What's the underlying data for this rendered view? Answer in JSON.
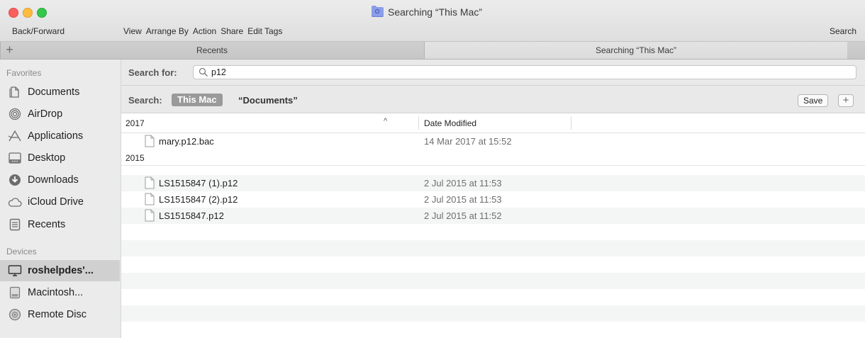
{
  "window": {
    "title": "Searching “This Mac”",
    "toolbar": {
      "back_forward": "Back/Forward",
      "menu": [
        "View",
        "Arrange By",
        "Action",
        "Share",
        "Edit Tags"
      ],
      "search": "Search"
    }
  },
  "tabs": [
    {
      "label": "Recents",
      "active": false
    },
    {
      "label": "Searching “This Mac”",
      "active": true
    }
  ],
  "tab_add_label": "+",
  "sidebar": {
    "favorites_header": "Favorites",
    "favorites": [
      {
        "label": "Documents",
        "icon": "documents-icon"
      },
      {
        "label": "AirDrop",
        "icon": "airdrop-icon"
      },
      {
        "label": "Applications",
        "icon": "applications-icon"
      },
      {
        "label": "Desktop",
        "icon": "desktop-icon"
      },
      {
        "label": "Downloads",
        "icon": "downloads-icon"
      },
      {
        "label": "iCloud Drive",
        "icon": "icloud-icon"
      },
      {
        "label": "Recents",
        "icon": "recents-icon"
      }
    ],
    "devices_header": "Devices",
    "devices": [
      {
        "label": "roshelpdes'...",
        "icon": "computer-icon",
        "selected": true
      },
      {
        "label": "Macintosh...",
        "icon": "hard-drive-icon",
        "selected": false
      },
      {
        "label": "Remote Disc",
        "icon": "disc-icon",
        "selected": false
      }
    ]
  },
  "search": {
    "label": "Search for:",
    "value": "p12"
  },
  "scope": {
    "label": "Search:",
    "this_mac": "This Mac",
    "documents": "“Documents”",
    "save_label": "Save",
    "add_label": "+"
  },
  "columns": {
    "name": "2017",
    "sort_indicator": "^",
    "date": "Date Modified"
  },
  "groups": [
    {
      "label": "2017",
      "files": [
        {
          "name": "mary.p12.bac",
          "date": "14 Mar 2017 at 15:52"
        }
      ]
    },
    {
      "label": "2015",
      "files": [
        {
          "name": "LS1515847 (1).p12",
          "date": "2 Jul 2015 at 11:53"
        },
        {
          "name": "LS1515847 (2).p12",
          "date": "2 Jul 2015 at 11:53"
        },
        {
          "name": "LS1515847.p12",
          "date": "2 Jul 2015 at 11:52"
        }
      ]
    }
  ]
}
